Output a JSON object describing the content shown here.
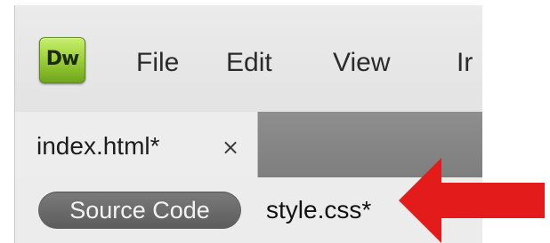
{
  "app": {
    "logo_text": "Dw",
    "logo_color": "#9fd23a"
  },
  "menu": {
    "items": [
      "File",
      "Edit",
      "View",
      "Ir"
    ]
  },
  "tabs": {
    "active_label": "index.html*",
    "close_glyph": "×"
  },
  "related_files": {
    "source_code_label": "Source Code",
    "file_label": "style.css*"
  },
  "annotation": {
    "arrow_color": "#e31b1b",
    "arrow_icon": "arrow-left-icon"
  }
}
